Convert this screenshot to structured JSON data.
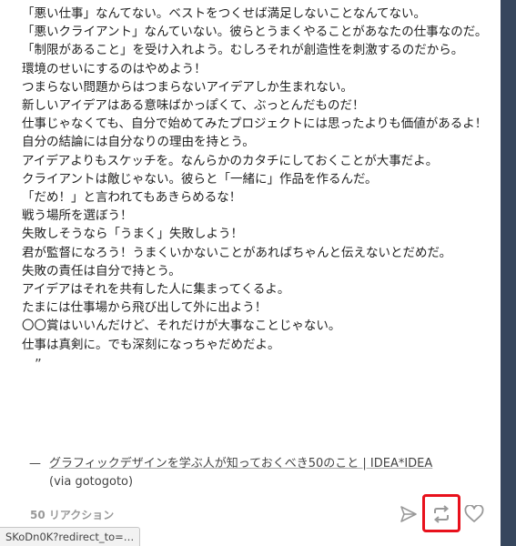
{
  "post": {
    "lines": [
      {
        "text": "「悪い仕事」なんてない。ベストをつくせば満足しないことなんてない。"
      },
      {
        "text": "「悪いクライアント」なんていない。彼らとうまくやることがあなたの仕事なのだ。",
        "wrap": true
      },
      {
        "text": "「制限があること」を受け入れよう。むしろそれが創造性を刺激するのだから。",
        "wrap": true
      },
      {
        "text": "環境のせいにするのはやめよう！"
      },
      {
        "text": "つまらない問題からはつまらないアイデアしか生まれない。"
      },
      {
        "text": "新しいアイデアはある意味ばかっぽくて、ぶっとんだものだ！"
      },
      {
        "text": "仕事じゃなくても、自分で始めてみたプロジェクトには思ったよりも価値があるよ！",
        "wrap": true
      },
      {
        "text": "自分の結論には自分なりの理由を持とう。"
      },
      {
        "text": "アイデアよりもスケッチを。なんらかのカタチにしておくことが大事だよ。"
      },
      {
        "text": "クライアントは敵じゃない。彼らと「一緒に」作品を作るんだ。"
      },
      {
        "text": "「だめ！」と言われてもあきらめるな！"
      },
      {
        "text": "戦う場所を選ぼう！"
      },
      {
        "text": "失敗しそうなら「うまく」失敗しよう！"
      },
      {
        "text": "君が監督になろう！うまくいかないことがあればちゃんと伝えないとだめだ。"
      },
      {
        "text": "失敗の責任は自分で持とう。"
      },
      {
        "text": "アイデアはそれを共有した人に集まってくるよ。"
      },
      {
        "text": "たまには仕事場から飛び出して外に出よう！"
      },
      {
        "text": "〇〇賞はいいんだけど、それだけが大事なことじゃない。"
      },
      {
        "text": "仕事は真剣に。でも深刻になっちゃだめだよ。"
      }
    ],
    "quote_close": "”",
    "source_dash": "—",
    "source_link": "グラフィックデザインを学ぶ人が知っておくべき50のこと | IDEA*IDEA",
    "source_via": " (via gotogoto)"
  },
  "footer": {
    "notes": "50 リアクション",
    "share_icon": "paper-plane-icon",
    "reblog_icon": "reblog-icon",
    "like_icon": "heart-icon",
    "highlight_color": "#e8111c"
  },
  "status_bar": {
    "url": "SKoDn0K?redirect_to=…"
  }
}
